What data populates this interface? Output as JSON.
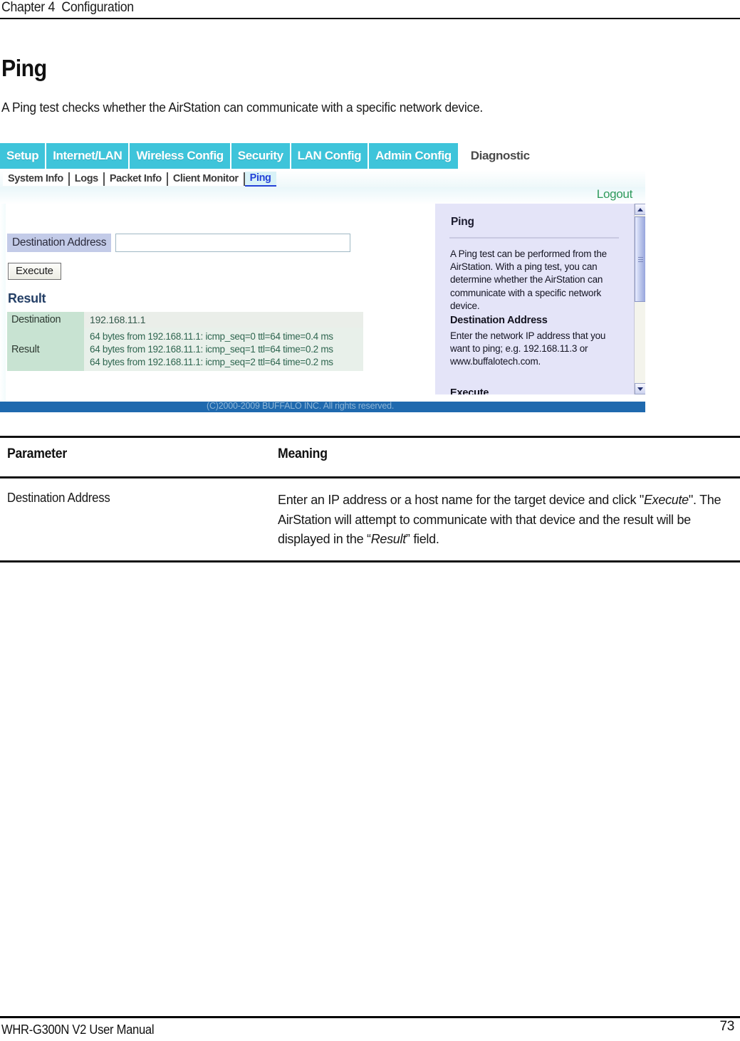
{
  "page": {
    "running_head": "Chapter 4  Configuration",
    "section_title": "Ping",
    "section_intro": "A Ping test checks whether the AirStation can communicate with a specific network device."
  },
  "screenshot": {
    "main_tabs": [
      {
        "label": "Setup",
        "active": false
      },
      {
        "label": "Internet/LAN",
        "active": false
      },
      {
        "label": "Wireless Config",
        "active": false
      },
      {
        "label": "Security",
        "active": false
      },
      {
        "label": "LAN Config",
        "active": false
      },
      {
        "label": "Admin Config",
        "active": false
      },
      {
        "label": "Diagnostic",
        "active": true
      }
    ],
    "sub_tabs": [
      {
        "label": "System Info",
        "active": false
      },
      {
        "label": "Logs",
        "active": false
      },
      {
        "label": "Packet Info",
        "active": false
      },
      {
        "label": "Client Monitor",
        "active": false
      },
      {
        "label": "Ping",
        "active": true
      }
    ],
    "logout_label": "Logout",
    "form": {
      "destination_address_label": "Destination Address",
      "destination_address_value": "",
      "execute_button_label": "Execute"
    },
    "result": {
      "heading": "Result",
      "destination_label": "Destination",
      "destination_value": "192.168.11.1",
      "result_label": "Result",
      "result_lines": "64 bytes from 192.168.11.1: icmp_seq=0 ttl=64 time=0.4 ms\n64 bytes from 192.168.11.1: icmp_seq=1 ttl=64 time=0.2 ms\n64 bytes from 192.168.11.1: icmp_seq=2 ttl=64 time=0.2 ms"
    },
    "help": {
      "title": "Ping",
      "paragraph1": "A Ping test can be performed from the AirStation. With a ping test, you can determine whether the AirStation can communicate with a specific network device.",
      "subheading1": "Destination Address",
      "paragraph2": "Enter the network IP address that you want to ping; e.g. 192.168.11.3 or www.buffalotech.com.",
      "subheading2": "Execute"
    },
    "copyright": "(C)2000-2009 BUFFALO INC. All rights reserved.",
    "colors": {
      "tab_teal": "#3ec4da",
      "active_subtab_text": "#2442d8",
      "logout_green": "#2f9a5c",
      "footer_blue": "#1f69ae",
      "field_label_lavender": "#c3cbe8",
      "result_key_green": "#c8e3d2",
      "help_panel_lavender": "#e4e4f8"
    }
  },
  "param_table": {
    "headers": {
      "parameter": "Parameter",
      "meaning": "Meaning"
    },
    "rows": [
      {
        "parameter": "Destination Address",
        "meaning_part1": "Enter an IP address or a host name for the target device and click \"",
        "meaning_italic1": "Execute",
        "meaning_part2": "\". The AirStation will attempt to communicate with that device and the result will be displayed in the “",
        "meaning_italic2": "Result",
        "meaning_part3": "” field."
      }
    ]
  },
  "footer": {
    "manual_title": "WHR-G300N V2 User Manual",
    "page_number": "73"
  }
}
